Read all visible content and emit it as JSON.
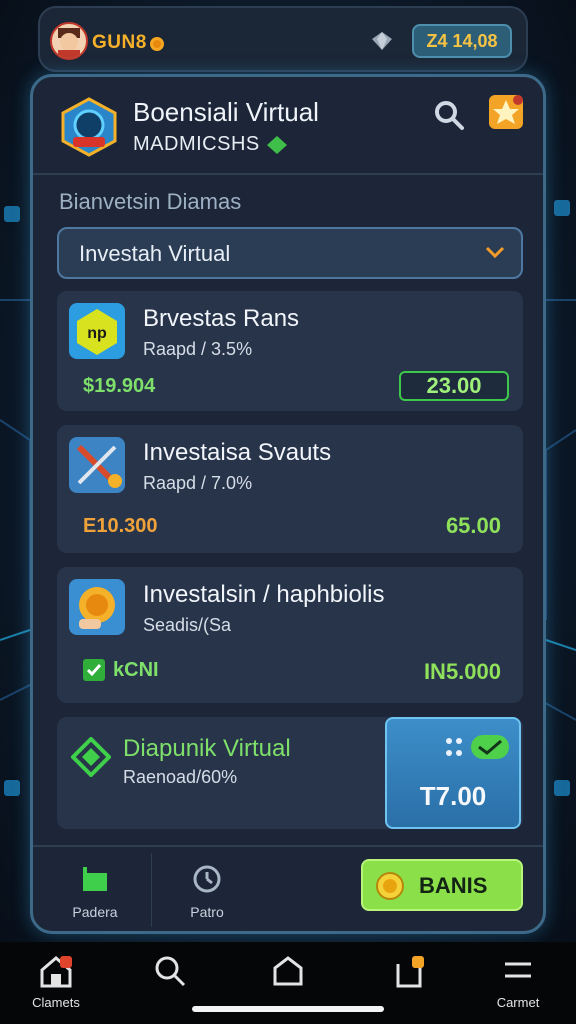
{
  "topbar": {
    "coin_label": "GUN8",
    "balance": "Z4 14,08"
  },
  "app": {
    "title": "Boensiali Virtual",
    "subtitle": "MADMICSHS"
  },
  "section_label": "Bianvetsin Diamas",
  "dropdown": {
    "value": "Investah Virtual"
  },
  "cards": [
    {
      "title": "Brvestas Rans",
      "sub": "Raapd / 3.5%",
      "left_value": "$19.904",
      "right_value": "23.00",
      "icon": "np-badge-icon"
    },
    {
      "title": "Investaisa Svauts",
      "sub": "Raapd / 7.0%",
      "left_value": "E10.300",
      "right_value": "65.00",
      "icon": "crossed-tools-icon"
    },
    {
      "title": "Investalsin / haphbiolis",
      "sub": "Seadis/(Sa",
      "left_value": "kCNI",
      "right_value": "IN5.000",
      "icon": "coin-hand-icon"
    },
    {
      "title": "Diapunik Virtual",
      "sub": "Raenoad/60%",
      "highlight_value": "T7.00",
      "icon": "green-diamond-icon"
    }
  ],
  "bottom_tabs": [
    {
      "label": "Padera",
      "icon": "wallet-icon"
    },
    {
      "label": "Patro",
      "icon": "clock-icon"
    }
  ],
  "cta": {
    "label": "BANIS"
  },
  "system_nav": [
    {
      "label": "Clamets",
      "icon": "home-badge-icon"
    },
    {
      "label": "",
      "icon": "search-icon"
    },
    {
      "label": "",
      "icon": "home-icon"
    },
    {
      "label": "",
      "icon": "bag-icon"
    },
    {
      "label": "Carmet",
      "icon": "menu-icon"
    }
  ],
  "colors": {
    "accent_green": "#8be04a",
    "accent_orange": "#f3a325",
    "panel_border": "#3e6a8a"
  }
}
